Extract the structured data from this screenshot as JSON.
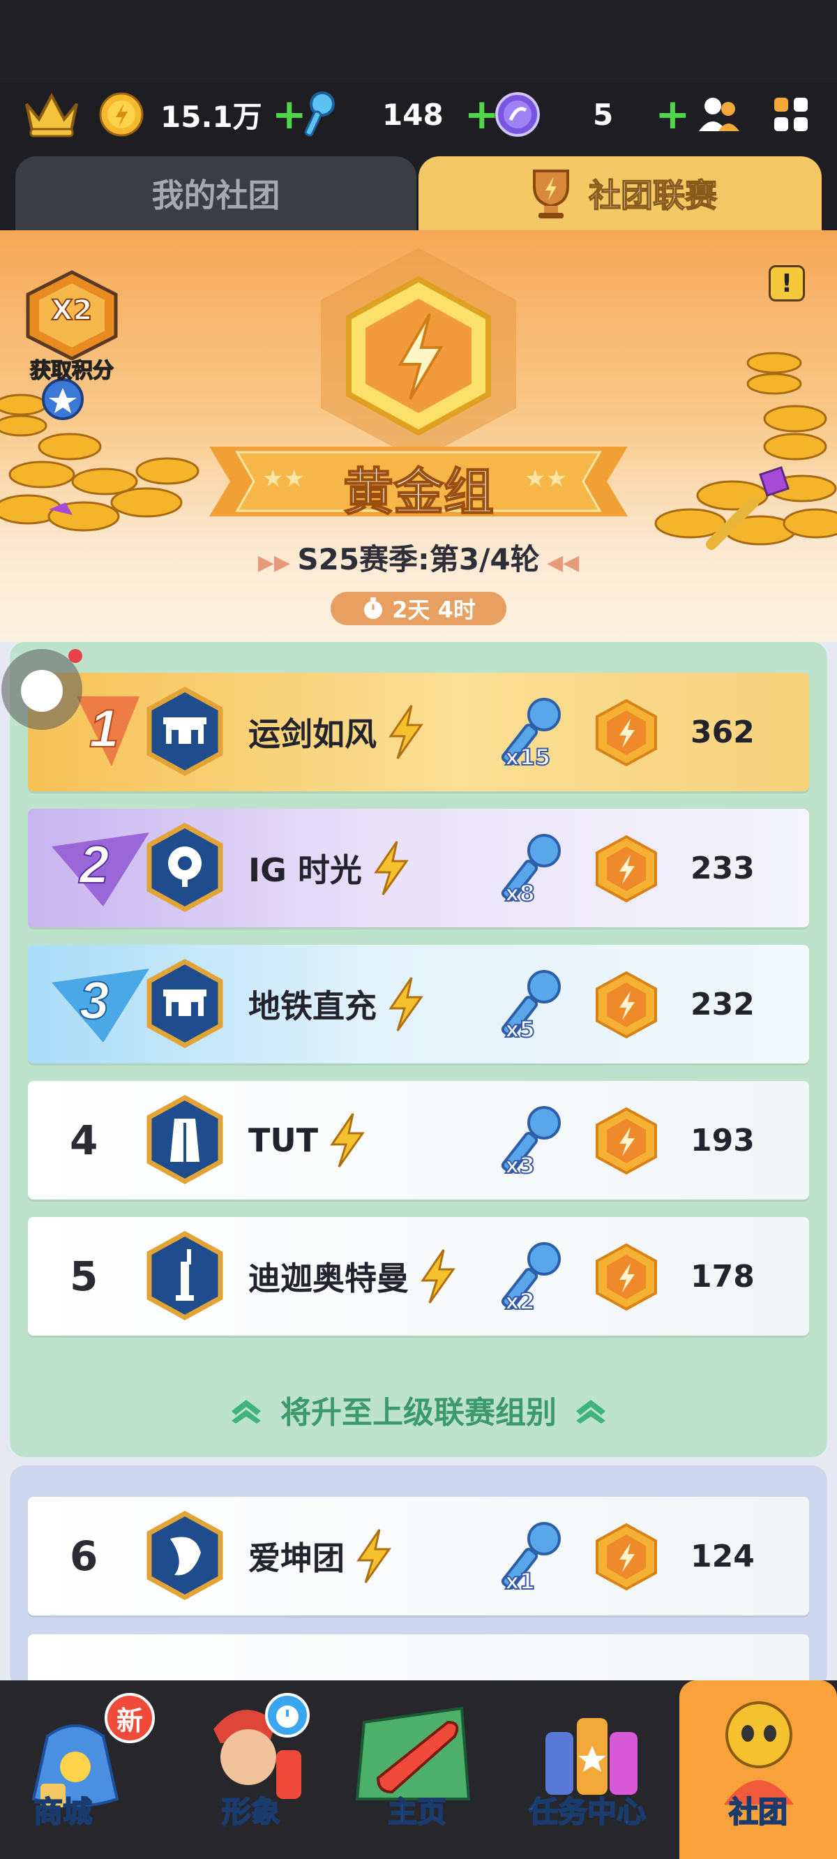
{
  "topbar": {
    "coins": "15.1万",
    "keys": "148",
    "gems": "5"
  },
  "tabs": {
    "my_club": "我的社团",
    "league": "社团联赛"
  },
  "hero": {
    "bonus_mult": "X2",
    "bonus_label": "获取积分",
    "division": "黄金组",
    "season": "S25赛季:第3/4轮",
    "timer": "2天 4时"
  },
  "rows": [
    {
      "rank": "1",
      "name": "运剑如风",
      "mult": "x15",
      "score": "362"
    },
    {
      "rank": "2",
      "name": "IG 时光",
      "mult": "x8",
      "score": "233"
    },
    {
      "rank": "3",
      "name": "地铁直充",
      "mult": "x5",
      "score": "232"
    },
    {
      "rank": "4",
      "name": "TUT",
      "mult": "x3",
      "score": "193"
    },
    {
      "rank": "5",
      "name": "迪迦奥特曼",
      "mult": "x2",
      "score": "178"
    },
    {
      "rank": "6",
      "name": "爱坤团",
      "mult": "x1",
      "score": "124"
    }
  ],
  "promotion_label": "将升至上级联赛组别",
  "nav": {
    "shop": "商城",
    "shop_badge": "新",
    "avatar": "形象",
    "home": "主页",
    "tasks": "任务中心",
    "club": "社团"
  },
  "colors": {
    "accent": "#f3c865",
    "promo_zone": "#bde3cc",
    "green_plus": "#4fd64b"
  }
}
